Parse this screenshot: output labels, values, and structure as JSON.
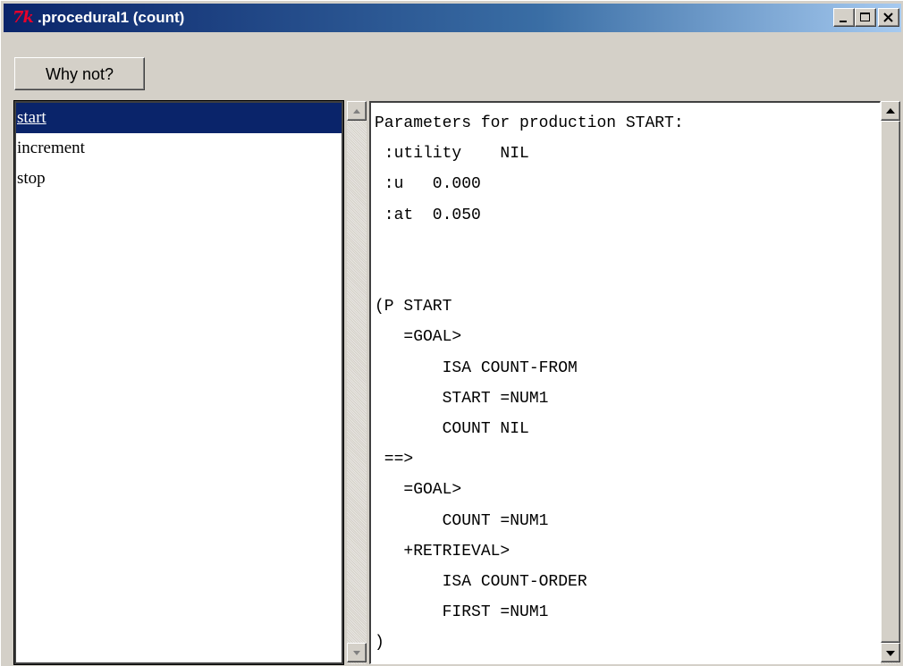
{
  "window": {
    "logo_text": "7k",
    "title": ".procedural1 (count)"
  },
  "toolbar": {
    "why_not_label": "Why not?"
  },
  "productions": {
    "items": [
      {
        "label": "start",
        "selected": true
      },
      {
        "label": "increment",
        "selected": false
      },
      {
        "label": "stop",
        "selected": false
      }
    ]
  },
  "details": {
    "lines": [
      "Parameters for production START:",
      " :utility    NIL",
      " :u   0.000",
      " :at  0.050",
      "",
      "",
      "(P START",
      "   =GOAL>",
      "       ISA COUNT-FROM",
      "       START =NUM1",
      "       COUNT NIL",
      " ==>",
      "   =GOAL>",
      "       COUNT =NUM1",
      "   +RETRIEVAL>",
      "       ISA COUNT-ORDER",
      "       FIRST =NUM1",
      ")"
    ]
  },
  "colors": {
    "selection_bg": "#0a246a",
    "titlebar_start": "#0a246a",
    "titlebar_end": "#a6caf0",
    "tk_logo": "#e8002a"
  }
}
